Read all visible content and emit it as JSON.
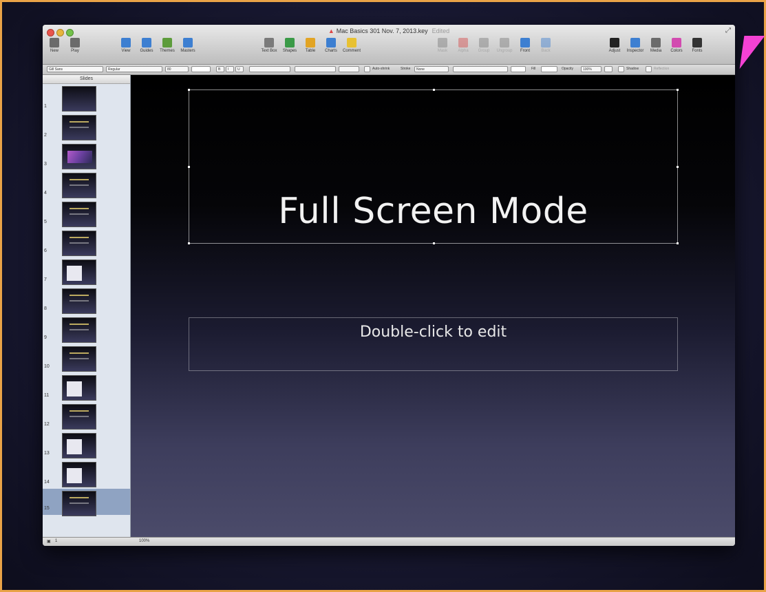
{
  "window": {
    "title": "Mac Basics 301 Nov. 7, 2013.key",
    "status": "Edited"
  },
  "toolbar": {
    "left": [
      {
        "label": "New",
        "icon": "new-icon",
        "color": "#6b6b6b"
      },
      {
        "label": "Play",
        "icon": "play-icon",
        "color": "#6b6b6b"
      }
    ],
    "view": [
      {
        "label": "View",
        "icon": "view-icon",
        "color": "#3d7fd1"
      },
      {
        "label": "Guides",
        "icon": "guides-icon",
        "color": "#3d7fd1"
      },
      {
        "label": "Themes",
        "icon": "themes-icon",
        "color": "#5d9c3b"
      },
      {
        "label": "Masters",
        "icon": "masters-icon",
        "color": "#3d7fd1"
      }
    ],
    "insert": [
      {
        "label": "Text Box",
        "icon": "text-box-icon",
        "color": "#7a7a7a"
      },
      {
        "label": "Shapes",
        "icon": "shapes-icon",
        "color": "#3a9a47"
      },
      {
        "label": "Table",
        "icon": "table-icon",
        "color": "#e2a424"
      },
      {
        "label": "Charts",
        "icon": "charts-icon",
        "color": "#3d7fd1"
      },
      {
        "label": "Comment",
        "icon": "comment-icon",
        "color": "#e8c132"
      }
    ],
    "arrange": [
      {
        "label": "Mask",
        "icon": "mask-icon",
        "color": "#7a7a7a",
        "disabled": true
      },
      {
        "label": "Alpha",
        "icon": "alpha-icon",
        "color": "#d44a4a",
        "disabled": true
      },
      {
        "label": "Group",
        "icon": "group-icon",
        "color": "#7a7a7a",
        "disabled": true
      },
      {
        "label": "Ungroup",
        "icon": "ungroup-icon",
        "color": "#7a7a7a",
        "disabled": true
      },
      {
        "label": "Front",
        "icon": "front-icon",
        "color": "#3d7fd1",
        "disabled": false
      },
      {
        "label": "Back",
        "icon": "back-icon",
        "color": "#3d7fd1",
        "disabled": true
      }
    ],
    "right": [
      {
        "label": "Adjust",
        "icon": "adjust-icon",
        "color": "#222222"
      },
      {
        "label": "Inspector",
        "icon": "inspector-icon",
        "color": "#3d7fd1"
      },
      {
        "label": "Media",
        "icon": "media-icon",
        "color": "#6b6b6b"
      },
      {
        "label": "Colors",
        "icon": "colors-icon",
        "color": "#d24bb0"
      },
      {
        "label": "Fonts",
        "icon": "fonts-icon",
        "color": "#333333"
      }
    ]
  },
  "format_bar": {
    "font": "Gill Sans",
    "style": "Regular",
    "size": "80",
    "auto_shrink": "Auto-shrink",
    "stroke_label": "Stroke",
    "stroke_value": "None",
    "fill_label": "Fill",
    "opacity_label": "Opacity",
    "opacity_value": "100%",
    "shadow": "Shadow",
    "reflection": "Reflection",
    "bold": "B",
    "italic": "I",
    "underline": "U"
  },
  "navigator": {
    "header": "Slides",
    "slides": [
      {
        "num": "1",
        "kind": "dark"
      },
      {
        "num": "2",
        "kind": "title"
      },
      {
        "num": "3",
        "kind": "purple"
      },
      {
        "num": "4",
        "kind": "title"
      },
      {
        "num": "5",
        "kind": "title"
      },
      {
        "num": "6",
        "kind": "title"
      },
      {
        "num": "7",
        "kind": "doc"
      },
      {
        "num": "8",
        "kind": "title"
      },
      {
        "num": "9",
        "kind": "title"
      },
      {
        "num": "10",
        "kind": "title"
      },
      {
        "num": "11",
        "kind": "doc"
      },
      {
        "num": "12",
        "kind": "title"
      },
      {
        "num": "13",
        "kind": "doc"
      },
      {
        "num": "14",
        "kind": "doc"
      },
      {
        "num": "15",
        "kind": "title",
        "selected": true
      }
    ]
  },
  "slide": {
    "title": "Full Screen Mode",
    "body_placeholder": "Double-click to edit"
  },
  "status_bar": {
    "view_label": "1",
    "zoom": "100%"
  },
  "colors": {
    "frame_border": "#e9a347",
    "arrow": "#f442d4"
  }
}
